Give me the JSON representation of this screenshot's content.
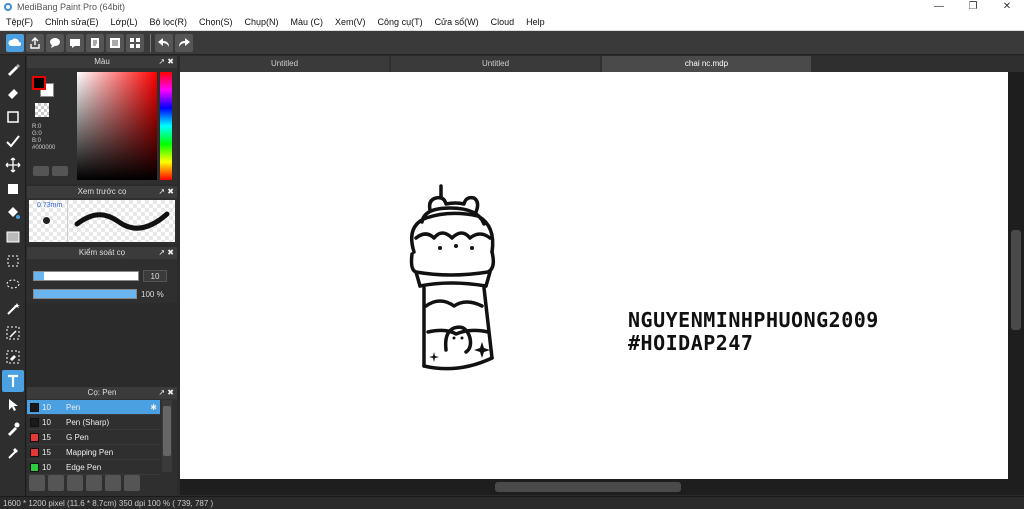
{
  "window": {
    "title": "MediBang Paint Pro (64bit)",
    "controls": [
      "—",
      "❐",
      "✕"
    ]
  },
  "menu": {
    "items": [
      "Tệp(F)",
      "Chỉnh sửa(E)",
      "Lớp(L)",
      "Bộ lọc(R)",
      "Chọn(S)",
      "Chụp(N)",
      "Màu (C)",
      "Xem(V)",
      "Công cụ(T)",
      "Cửa sổ(W)",
      "Cloud",
      "Help"
    ]
  },
  "panels": {
    "color": {
      "title": "Màu",
      "rgb": [
        "R:0",
        "G:0",
        "B:0",
        "#000000"
      ],
      "controls": "↗ ✖"
    },
    "brush_preview": {
      "title": "Xem trước cọ",
      "size": "0.73mm",
      "controls": "↗ ✖"
    },
    "brush_control": {
      "title": "Kiểm soát cọ",
      "size_value": "10",
      "size_fraction": 0.1,
      "opacity_value": "100 %",
      "opacity_fraction": 1.0,
      "controls": "↗ ✖"
    },
    "brush_list": {
      "title": "Cọ: Pen",
      "controls": "↗ ✖",
      "items": [
        {
          "size": "10",
          "name": "Pen",
          "color": "#1a1a1a",
          "selected": true
        },
        {
          "size": "10",
          "name": "Pen (Sharp)",
          "color": "#1a1a1a",
          "selected": false
        },
        {
          "size": "15",
          "name": "G Pen",
          "color": "#e53935",
          "selected": false
        },
        {
          "size": "15",
          "name": "Mapping Pen",
          "color": "#e53935",
          "selected": false
        },
        {
          "size": "10",
          "name": "Edge Pen",
          "color": "#2ecc40",
          "selected": false
        }
      ]
    }
  },
  "tabs": [
    {
      "label": "Untitled",
      "active": false
    },
    {
      "label": "Untitled",
      "active": false
    },
    {
      "label": "chai nc.mdp",
      "active": true
    }
  ],
  "canvas": {
    "text_line1": "NGUYENMINHPHUONG2009",
    "text_line2": "#HOIDAP247"
  },
  "status": {
    "text": "1600 * 1200 pixel   (11.6 * 8.7cm)   350 dpi   100 %   ( 739, 787 )"
  },
  "colors": {
    "accent": "#4aa0e0",
    "panel_bg": "#2f2f2f"
  }
}
